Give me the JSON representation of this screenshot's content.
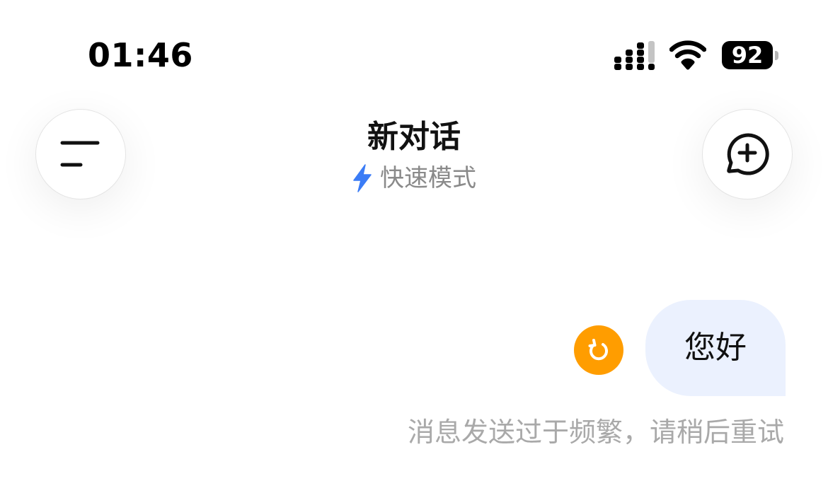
{
  "status_bar": {
    "time": "01:46",
    "battery": "92",
    "icons": [
      "signal-icon",
      "wifi-icon",
      "battery-icon"
    ]
  },
  "header": {
    "title": "新对话",
    "mode_label": "快速模式",
    "menu_icon": "menu-icon",
    "new_chat_icon": "new-chat-icon",
    "mode_icon": "lightning-bolt-icon"
  },
  "chat": {
    "messages": [
      {
        "role": "user",
        "text": "您好",
        "status_icon": "retry-icon"
      }
    ],
    "error_text": "消息发送过于频繁，请稍后重试"
  },
  "colors": {
    "accent_blue": "#3b7cf6",
    "retry_orange": "#ff9d00",
    "bubble_background": "#ebf1fe",
    "muted_text": "#a9a9a9"
  }
}
